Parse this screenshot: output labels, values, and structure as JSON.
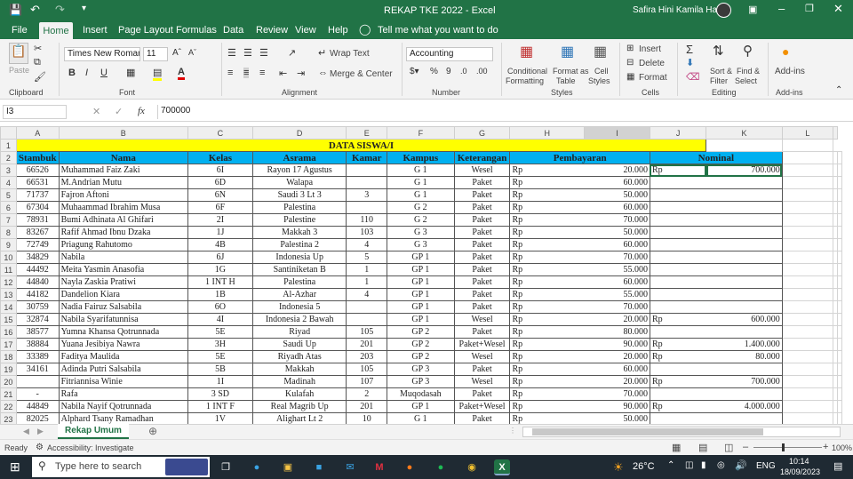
{
  "window": {
    "title": "REKAP TKE 2022  -  Excel",
    "user": "Safira Hini Kamila Hadi",
    "search_hint": "Tell me what you want to do"
  },
  "tabs": [
    "File",
    "Home",
    "Insert",
    "Page Layout",
    "Formulas",
    "Data",
    "Review",
    "View",
    "Help"
  ],
  "ribbon": {
    "clipboard": {
      "paste": "Paste",
      "label": "Clipboard"
    },
    "font": {
      "name": "Times New Roman",
      "size": "11",
      "bold": "B",
      "italic": "I",
      "underline": "U",
      "label": "Font"
    },
    "alignment": {
      "wrap": "Wrap Text",
      "merge": "Merge & Center",
      "label": "Alignment"
    },
    "number": {
      "format": "Accounting",
      "label": "Number"
    },
    "styles": {
      "cond": "Conditional",
      "cond2": "Formatting",
      "fmt": "Format as",
      "fmt2": "Table",
      "cell": "Cell",
      "cell2": "Styles",
      "label": "Styles"
    },
    "cells": {
      "insert": "Insert",
      "delete": "Delete",
      "format": "Format",
      "label": "Cells"
    },
    "editing": {
      "sort": "Sort &",
      "sort2": "Filter",
      "find": "Find &",
      "find2": "Select",
      "label": "Editing"
    },
    "addins": {
      "btn": "Add-ins",
      "label": "Add-ins"
    }
  },
  "formula_bar": {
    "cell_ref": "I3",
    "fx": "fx",
    "value": "700000"
  },
  "columns": [
    "A",
    "B",
    "C",
    "D",
    "E",
    "F",
    "G",
    "H",
    "I",
    "J",
    "K",
    "L"
  ],
  "sheet": {
    "title": "DATA SISWA/I",
    "headers": [
      "Stambuk",
      "Nama",
      "Kelas",
      "Asrama",
      "Kamar",
      "Kampus",
      "Keterangan",
      "Pembayaran",
      "Nominal"
    ],
    "rows": [
      [
        "66526",
        "Muhammad Faiz Zaki",
        "6I",
        "Rayon 17 Agustus",
        "",
        "G 1",
        "Wesel",
        "Rp",
        "20.000",
        "Rp",
        "700.000"
      ],
      [
        "66531",
        "M.Andrian Mutu",
        "6D",
        "Walapa",
        "",
        "G 1",
        "Paket",
        "Rp",
        "60.000",
        "",
        ""
      ],
      [
        "71737",
        "Fajron Aftoni",
        "6N",
        "Saudi 3 Lt 3",
        "3",
        "G 1",
        "Paket",
        "Rp",
        "50.000",
        "",
        ""
      ],
      [
        "67304",
        "Muhaammad Ibrahim Musa",
        "6F",
        "Palestina",
        "",
        "G 2",
        "Paket",
        "Rp",
        "60.000",
        "",
        ""
      ],
      [
        "78931",
        "Bumi Adhinata Al Ghifari",
        "2I",
        "Palestine",
        "110",
        "G 2",
        "Paket",
        "Rp",
        "70.000",
        "",
        ""
      ],
      [
        "83267",
        "Rafif Ahmad Ibnu Dzaka",
        "1J",
        "Makkah 3",
        "103",
        "G 3",
        "Paket",
        "Rp",
        "50.000",
        "",
        ""
      ],
      [
        "72749",
        "Priagung Rahutomo",
        "4B",
        "Palestina 2",
        "4",
        "G 3",
        "Paket",
        "Rp",
        "60.000",
        "",
        ""
      ],
      [
        "34829",
        "Nabila",
        "6J",
        "Indonesia Up",
        "5",
        "GP 1",
        "Paket",
        "Rp",
        "70.000",
        "",
        ""
      ],
      [
        "44492",
        "Meita Yasmin Anasofia",
        "1G",
        "Santiniketan B",
        "1",
        "GP 1",
        "Paket",
        "Rp",
        "55.000",
        "",
        ""
      ],
      [
        "44840",
        "Nayla Zaskia Pratiwi",
        "1 INT H",
        "Palestina",
        "1",
        "GP 1",
        "Paket",
        "Rp",
        "60.000",
        "",
        ""
      ],
      [
        "44182",
        "Dandelion Kiara",
        "1B",
        "Al-Azhar",
        "4",
        "GP 1",
        "Paket",
        "Rp",
        "55.000",
        "",
        ""
      ],
      [
        "30759",
        "Nadia Fairuz Salsabila",
        "6O",
        "Indonesia 5",
        "",
        "GP 1",
        "Paket",
        "Rp",
        "70.000",
        "",
        ""
      ],
      [
        "32874",
        "Nabila Syarifatunnisa",
        "4I",
        "Indonesia 2 Bawah",
        "",
        "GP 1",
        "Wesel",
        "Rp",
        "20.000",
        "Rp",
        "600.000"
      ],
      [
        "38577",
        "Yumna Khansa Qotrunnada",
        "5E",
        "Riyad",
        "105",
        "GP 2",
        "Paket",
        "Rp",
        "80.000",
        "",
        ""
      ],
      [
        "38884",
        "Yuana Jesibiya Nawra",
        "3H",
        "Saudi Up",
        "201",
        "GP 2",
        "Paket+Wesel",
        "Rp",
        "90.000",
        "Rp",
        "1.400.000"
      ],
      [
        "33389",
        "Faditya Maulida",
        "5E",
        "Riyadh Atas",
        "203",
        "GP 2",
        "Wesel",
        "Rp",
        "20.000",
        "Rp",
        "80.000"
      ],
      [
        "34161",
        "Adinda Putri Salsabila",
        "5B",
        "Makkah",
        "105",
        "GP 3",
        "Paket",
        "Rp",
        "60.000",
        "",
        ""
      ],
      [
        "",
        "Fitriannisa Winie",
        "1I",
        "Madinah",
        "107",
        "GP 3",
        "Wesel",
        "Rp",
        "20.000",
        "Rp",
        "700.000"
      ],
      [
        "-",
        "Rafa",
        "3 SD",
        "Kulafah",
        "2",
        "Muqodasah",
        "Paket",
        "Rp",
        "70.000",
        "",
        ""
      ],
      [
        "44849",
        "Nabila Nayif Qotrunnada",
        "1 INT F",
        "Real Magrib Up",
        "201",
        "GP 1",
        "Paket+Wesel",
        "Rp",
        "90.000",
        "Rp",
        "4.000.000"
      ],
      [
        "82025",
        "Alphard Tsany Ramadhan",
        "1V",
        "Alighart Lt 2",
        "10",
        "G 1",
        "Paket",
        "Rp",
        "50.000",
        "",
        ""
      ]
    ]
  },
  "sheet_tabs": [
    "Rekap Umum"
  ],
  "status": {
    "ready": "Ready",
    "accessibility": "Accessibility: Investigate",
    "zoom": "100%"
  },
  "taskbar": {
    "search": "Type here to search",
    "temp": "26°C",
    "lang": "ENG",
    "time": "10:14",
    "date": "18/09/2023"
  }
}
